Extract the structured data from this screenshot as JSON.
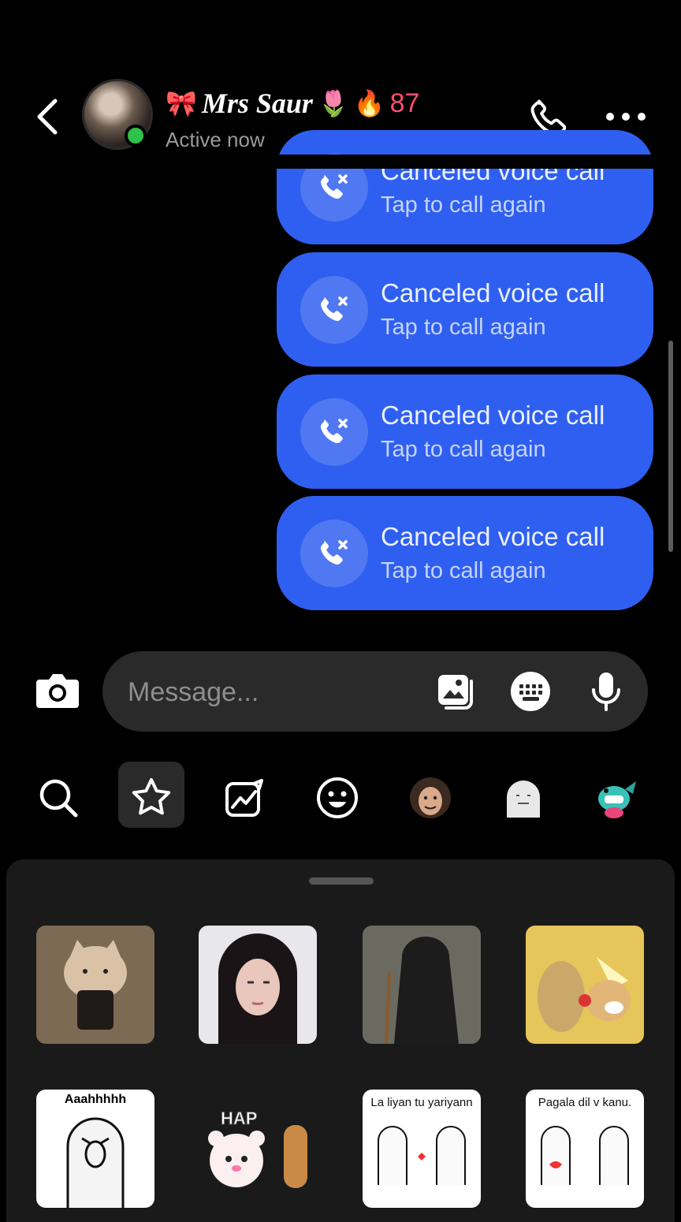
{
  "header": {
    "contact_name": "Mrs Saur",
    "name_prefix_emoji": "🎀",
    "name_suffix_emoji": "🌷",
    "streak_emoji": "🔥",
    "streak_count": "87",
    "status": "Active now"
  },
  "messages": [
    {
      "title": "Canceled voice call",
      "subtitle": "Tap to call again"
    },
    {
      "title": "Canceled voice call",
      "subtitle": "Tap to call again"
    },
    {
      "title": "Canceled voice call",
      "subtitle": "Tap to call again"
    },
    {
      "title": "Canceled voice call",
      "subtitle": "Tap to call again"
    }
  ],
  "composer": {
    "placeholder": "Message..."
  },
  "sticker_tabs": [
    "search",
    "favorites",
    "trending",
    "emoji",
    "avatar-face",
    "ghost-sticker",
    "fish-sticker"
  ],
  "stickers": [
    {
      "name": "cat-sticker"
    },
    {
      "name": "girl-sticker"
    },
    {
      "name": "cloaked-figure-sticker"
    },
    {
      "name": "doge-meme-sticker"
    },
    {
      "name": "aaah-meme-sticker",
      "caption": "Aaahhhhh"
    },
    {
      "name": "bears-hap-sticker",
      "caption": "HAP"
    },
    {
      "name": "yariyann-sticker",
      "caption": "La liyan tu yariyann"
    },
    {
      "name": "pagala-dil-sticker",
      "caption": "Pagala dil v kanu."
    }
  ],
  "colors": {
    "bubble": "#2f5ff0",
    "online": "#2fc14a",
    "streak": "#ff4d6d",
    "background": "#000000"
  }
}
